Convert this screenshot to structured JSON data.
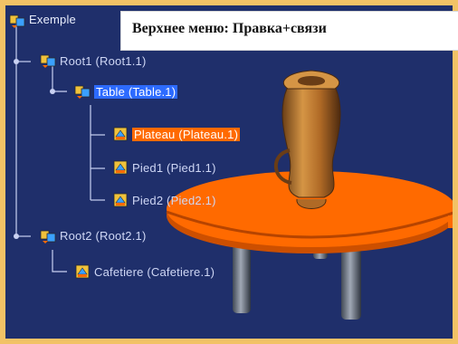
{
  "banner": {
    "text": "Верхнее меню: Правка+связи"
  },
  "tree": {
    "root_label": "Exemple",
    "items": [
      {
        "label": "Root1 (Root1.1)"
      },
      {
        "label": "Table (Table.1)"
      },
      {
        "label": "Plateau (Plateau.1)"
      },
      {
        "label": "Pied1 (Pied1.1)"
      },
      {
        "label": "Pied2 (Pied2.1)"
      },
      {
        "label": "Root2 (Root2.1)"
      },
      {
        "label": "Cafetiere (Cafetiere.1)"
      }
    ]
  },
  "colors": {
    "background": "#1f2f6b",
    "frame": "#f2c266",
    "selection": "#2d6bff",
    "highlight": "#ff6a00",
    "table_top": "#ff6a00",
    "table_top_shadow": "#cc4f00",
    "legs": "#7a8190",
    "vase": "#c07a2d"
  }
}
